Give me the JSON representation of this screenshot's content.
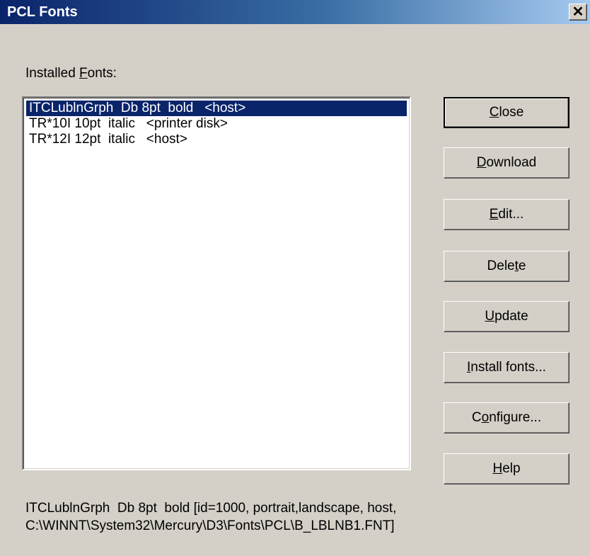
{
  "window": {
    "title": "PCL Fonts",
    "close_glyph": "✕"
  },
  "installed_label": {
    "before": "Installed ",
    "accel": "F",
    "after": "onts:"
  },
  "fonts_list": [
    {
      "text": "ITCLublnGrph  Db 8pt  bold   <host>",
      "selected": true
    },
    {
      "text": "TR*10I 10pt  italic   <printer disk>",
      "selected": false
    },
    {
      "text": "TR*12I 12pt  italic   <host>",
      "selected": false
    }
  ],
  "buttons": [
    {
      "before": "",
      "accel": "C",
      "after": "lose"
    },
    {
      "before": "",
      "accel": "D",
      "after": "ownload"
    },
    {
      "before": "",
      "accel": "E",
      "after": "dit..."
    },
    {
      "before": "Dele",
      "accel": "t",
      "after": "e"
    },
    {
      "before": "",
      "accel": "U",
      "after": "pdate"
    },
    {
      "before": "",
      "accel": "I",
      "after": "nstall fonts..."
    },
    {
      "before": "C",
      "accel": "o",
      "after": "nfigure..."
    },
    {
      "before": "",
      "accel": "H",
      "after": "elp"
    }
  ],
  "status": {
    "line1": "ITCLublnGrph  Db 8pt  bold [id=1000, portrait,landscape, host,",
    "line2": "C:\\WINNT\\System32\\Mercury\\D3\\Fonts\\PCL\\B_LBLNB1.FNT]"
  },
  "colors": {
    "face": "#d4d0c8",
    "selection": "#0a246a",
    "title_gradient_start": "#0a246a",
    "title_gradient_end": "#a6caf0"
  }
}
